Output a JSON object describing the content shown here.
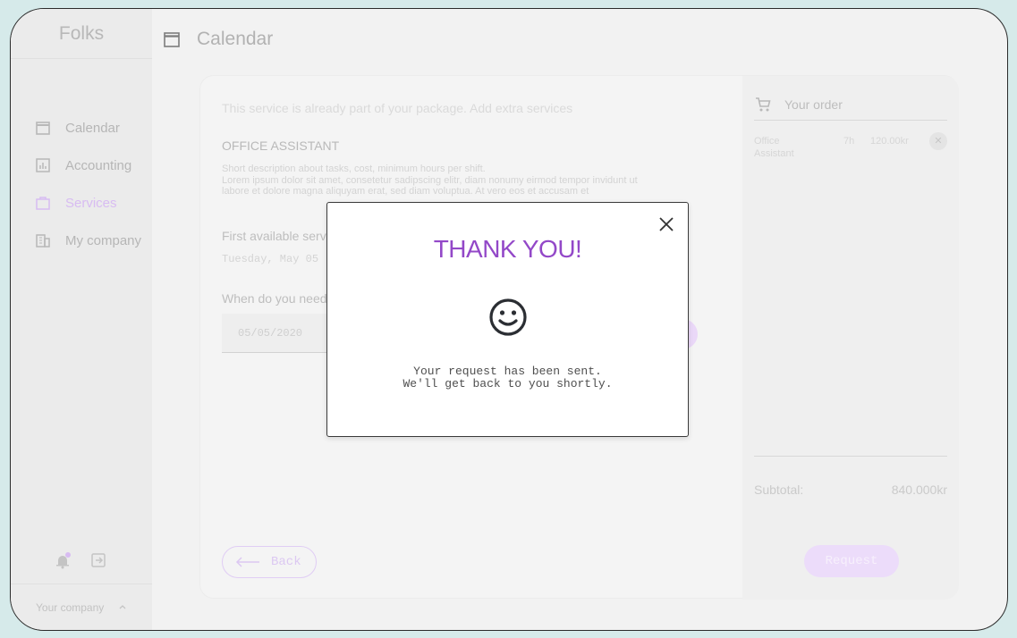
{
  "sidebar": {
    "brand": "Folks",
    "items": [
      {
        "label": "Calendar",
        "icon": "calendar-icon"
      },
      {
        "label": "Accounting",
        "icon": "bar-chart-icon"
      },
      {
        "label": "Services",
        "icon": "briefcase-icon",
        "active": true
      },
      {
        "label": "My company",
        "icon": "building-icon"
      }
    ],
    "footer": {
      "label": "Your company",
      "toggle_icon": "chevron-up-icon"
    },
    "tools": [
      "bell-icon",
      "logout-icon"
    ]
  },
  "header": {
    "title": "Calendar",
    "icon": "calendar-icon"
  },
  "service": {
    "intro": "This service is already part of your package. Add extra services",
    "title": "OFFICE ASSISTANT",
    "desc_line1": "Short description about tasks, cost, minimum hours per shift.",
    "desc_line2": "Lorem ipsum dolor sit amet, consetetur sadipscing elitr, diam nonumy eirmod tempor invidunt ut",
    "desc_line3": "labore et dolore magna aliquyam erat, sed diam voluptua. At vero eos et accusam et",
    "first_available_label": "First available serv",
    "first_available_value": "Tuesday, May 05",
    "when_label": "When do you need",
    "date_value": "05/05/2020",
    "back_label": "Back"
  },
  "order": {
    "title": "Your order",
    "line": {
      "name_1": "Office",
      "name_2": "Assistant",
      "hours": "7h",
      "price": "120.00kr",
      "remove": "✕"
    },
    "subtotal_label": "Subtotal:",
    "subtotal_value": "840.000kr",
    "request_label": "Request"
  },
  "modal": {
    "title": "THANK YOU!",
    "icon": "smiley-icon",
    "message_line1": "Your request has been sent.",
    "message_line2": "We'll get back to you shortly.",
    "close_icon": "close-icon"
  },
  "colors": {
    "accent": "#9348c8",
    "accent_light": "#d8bcf2",
    "background": "#d6eaea"
  }
}
